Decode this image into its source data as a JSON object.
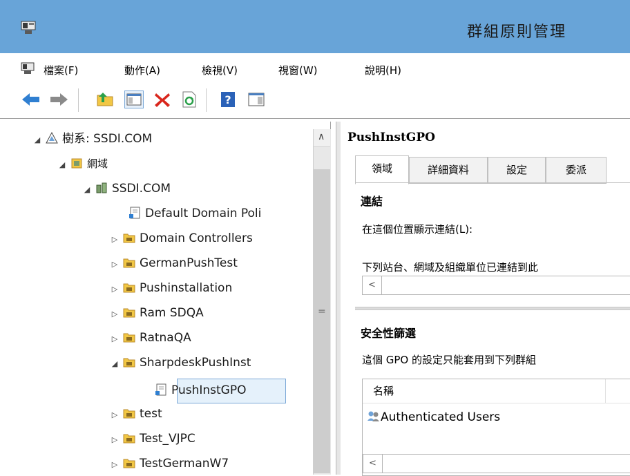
{
  "window": {
    "title": "群組原則管理"
  },
  "menu": [
    {
      "label": "檔案(F)"
    },
    {
      "label": "動作(A)"
    },
    {
      "label": "檢視(V)"
    },
    {
      "label": "視窗(W)"
    },
    {
      "label": "說明(H)"
    }
  ],
  "toolbar": {
    "icons": [
      "back-arrow-icon",
      "forward-arrow-icon",
      "up-folder-icon",
      "show-hide-tree-icon",
      "delete-x-icon",
      "refresh-icon",
      "help-icon",
      "properties-pane-icon"
    ],
    "colors": {
      "back": "#2f7fd1",
      "delete": "#d9261c",
      "help": "#2b62b8"
    }
  },
  "tree": {
    "forest": "樹系: SSDI.COM",
    "domains": "網域",
    "domain": "SSDI.COM",
    "items": [
      {
        "label": "Default Domain Poli",
        "expander": ""
      },
      {
        "label": "Domain Controllers",
        "expander": "▷"
      },
      {
        "label": "GermanPushTest",
        "expander": "▷"
      },
      {
        "label": "Pushinstallation",
        "expander": "▷"
      },
      {
        "label": "Ram SDQA",
        "expander": "▷"
      },
      {
        "label": "RatnaQA",
        "expander": "▷"
      },
      {
        "label": "SharpdeskPushInst",
        "expander": "◢"
      },
      {
        "label": "PushInstGPO",
        "expander": ""
      },
      {
        "label": "test",
        "expander": "▷"
      },
      {
        "label": "Test_VJPC",
        "expander": "▷"
      },
      {
        "label": "TestGermanW7",
        "expander": "▷"
      }
    ],
    "collapse_glyph": "◢",
    "scrollbar": {
      "up": "∧",
      "grip": "="
    }
  },
  "detail": {
    "title": "PushInstGPO",
    "tabs": [
      "領域",
      "詳細資料",
      "設定",
      "委派"
    ],
    "links_heading": "連結",
    "links_location_label": "在這個位置顯示連結(L):",
    "links_desc": "下列站台、網域及組織單位已連結到此",
    "scroll_left": "<",
    "security_heading": "安全性篩選",
    "security_desc": "這個 GPO 的設定只能套用到下列群組",
    "list_column": "名稱",
    "list_rows": [
      "Authenticated Users"
    ]
  }
}
